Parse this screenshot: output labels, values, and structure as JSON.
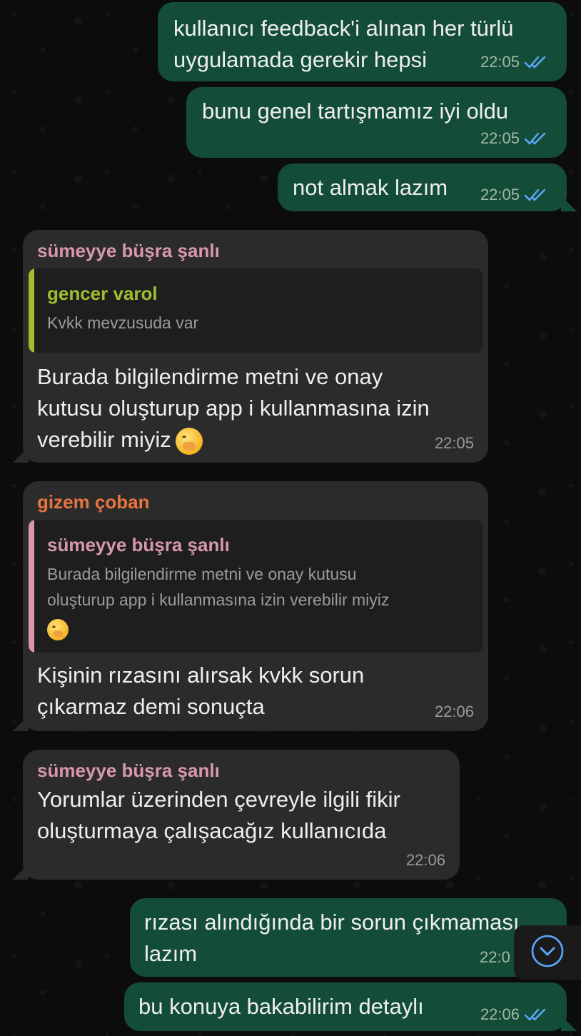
{
  "messages": [
    {
      "text": "kullanıcı feedback'i alınan her türlü\nuygulamada gerekir hepsi",
      "time": "22:05"
    },
    {
      "text": "bunu genel tartışmamız iyi oldu",
      "time": "22:05"
    },
    {
      "text": "not almak lazım",
      "time": "22:05"
    },
    {
      "sender": "sümeyye büşra şanlı",
      "quote_name": "gencer varol",
      "quote_text": "Kvkk mevzusuda var",
      "text": "Burada bilgilendirme metni ve onay\nkutusu oluşturup app i kullanmasına izin\nverebilir miyiz",
      "emoji": "face-with-hand-over-mouth",
      "time": "22:05"
    },
    {
      "sender": "gizem çoban",
      "quote_name": "sümeyye büşra şanlı",
      "quote_text": "Burada bilgilendirme metni ve onay kutusu\noluşturup app i kullanmasına izin verebilir miyiz",
      "quote_emoji": "face-with-hand-over-mouth",
      "text": "Kişinin rızasını alırsak kvkk sorun\nçıkarmaz demi sonuçta",
      "time": "22:06"
    },
    {
      "sender": "sümeyye büşra şanlı",
      "text": "Yorumlar üzerinden çevreyle ilgili fikir\noluşturmaya çalışacağız kullanıcıda",
      "time": "22:06"
    },
    {
      "text": "rızası alındığında bir sorun çıkmaması\nlazım",
      "time": "22:0"
    },
    {
      "text": "bu konuya bakabilirim detaylı",
      "time": "22:06"
    }
  ],
  "colors": {
    "outgoing_bubble": "#144d37",
    "incoming_bubble": "#2b2b2b",
    "read_ticks": "#5aa8ff",
    "sender_sumeyye": "#d897ad",
    "sender_gizem": "#e8743f",
    "quote_gencer": "#9fbe2f"
  },
  "icons": {
    "read_status": "double-check-icon",
    "scroll_down": "chevron-down-circle-icon"
  }
}
